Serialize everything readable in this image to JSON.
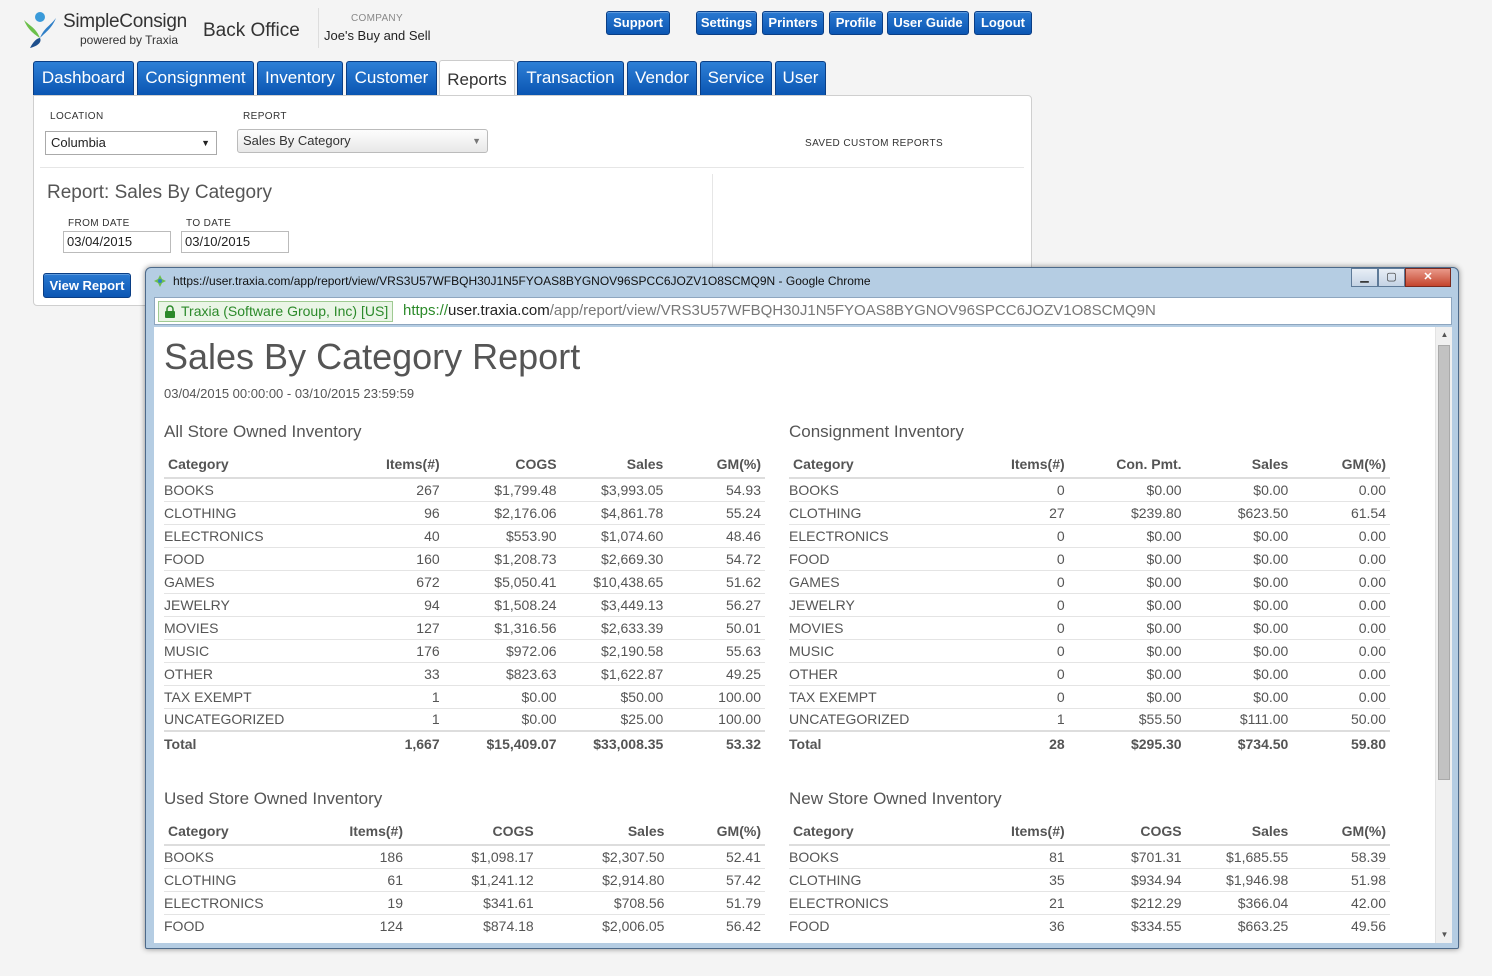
{
  "brand": {
    "name": "SimpleConsign",
    "tagline": "powered by Traxia",
    "app_title": "Back Office"
  },
  "company": {
    "label": "COMPANY",
    "name": "Joe's Buy and Sell"
  },
  "top_buttons": [
    "Support",
    "Settings",
    "Printers",
    "Profile",
    "User Guide",
    "Logout"
  ],
  "tabs": [
    "Dashboard",
    "Consignment",
    "Inventory",
    "Customer",
    "Reports",
    "Transaction",
    "Vendor",
    "Service",
    "User"
  ],
  "active_tab": "Reports",
  "filters": {
    "location_label": "LOCATION",
    "location_value": "Columbia",
    "report_label": "REPORT",
    "report_value": "Sales By Category",
    "saved_label": "SAVED CUSTOM REPORTS",
    "heading": "Report: Sales By Category",
    "from_label": "FROM DATE",
    "from_value": "03/04/2015",
    "to_label": "TO DATE",
    "to_value": "03/10/2015",
    "view_button": "View Report"
  },
  "browser": {
    "title": "https://user.traxia.com/app/report/view/VRS3U57WFBQH30J1N5FYOAS8BYGNOV96SPCC6JOZV1O8SCMQ9N - Google Chrome",
    "ev_name": "Traxia (Software Group, Inc) [US]",
    "url_scheme": "https://",
    "url_host": "user.traxia.com",
    "url_path": "/app/report/view/VRS3U57WFBQH30J1N5FYOAS8BYGNOV96SPCC6JOZV1O8SCMQ9N"
  },
  "report": {
    "title": "Sales By Category Report",
    "range": "03/04/2015 00:00:00 - 03/10/2015 23:59:59",
    "sections": [
      {
        "title": "All Store Owned Inventory",
        "headers": [
          "Category",
          "Items(#)",
          "COGS",
          "Sales",
          "GM(%)"
        ],
        "rows": [
          [
            "BOOKS",
            "267",
            "$1,799.48",
            "$3,993.05",
            "54.93"
          ],
          [
            "CLOTHING",
            "96",
            "$2,176.06",
            "$4,861.78",
            "55.24"
          ],
          [
            "ELECTRONICS",
            "40",
            "$553.90",
            "$1,074.60",
            "48.46"
          ],
          [
            "FOOD",
            "160",
            "$1,208.73",
            "$2,669.30",
            "54.72"
          ],
          [
            "GAMES",
            "672",
            "$5,050.41",
            "$10,438.65",
            "51.62"
          ],
          [
            "JEWELRY",
            "94",
            "$1,508.24",
            "$3,449.13",
            "56.27"
          ],
          [
            "MOVIES",
            "127",
            "$1,316.56",
            "$2,633.39",
            "50.01"
          ],
          [
            "MUSIC",
            "176",
            "$972.06",
            "$2,190.58",
            "55.63"
          ],
          [
            "OTHER",
            "33",
            "$823.63",
            "$1,622.87",
            "49.25"
          ],
          [
            "TAX EXEMPT",
            "1",
            "$0.00",
            "$50.00",
            "100.00"
          ],
          [
            "UNCATEGORIZED",
            "1",
            "$0.00",
            "$25.00",
            "100.00"
          ]
        ],
        "total": [
          "Total",
          "1,667",
          "$15,409.07",
          "$33,008.35",
          "53.32"
        ]
      },
      {
        "title": "Consignment Inventory",
        "headers": [
          "Category",
          "Items(#)",
          "Con. Pmt.",
          "Sales",
          "GM(%)"
        ],
        "rows": [
          [
            "BOOKS",
            "0",
            "$0.00",
            "$0.00",
            "0.00"
          ],
          [
            "CLOTHING",
            "27",
            "$239.80",
            "$623.50",
            "61.54"
          ],
          [
            "ELECTRONICS",
            "0",
            "$0.00",
            "$0.00",
            "0.00"
          ],
          [
            "FOOD",
            "0",
            "$0.00",
            "$0.00",
            "0.00"
          ],
          [
            "GAMES",
            "0",
            "$0.00",
            "$0.00",
            "0.00"
          ],
          [
            "JEWELRY",
            "0",
            "$0.00",
            "$0.00",
            "0.00"
          ],
          [
            "MOVIES",
            "0",
            "$0.00",
            "$0.00",
            "0.00"
          ],
          [
            "MUSIC",
            "0",
            "$0.00",
            "$0.00",
            "0.00"
          ],
          [
            "OTHER",
            "0",
            "$0.00",
            "$0.00",
            "0.00"
          ],
          [
            "TAX EXEMPT",
            "0",
            "$0.00",
            "$0.00",
            "0.00"
          ],
          [
            "UNCATEGORIZED",
            "1",
            "$55.50",
            "$111.00",
            "50.00"
          ]
        ],
        "total": [
          "Total",
          "28",
          "$295.30",
          "$734.50",
          "59.80"
        ]
      },
      {
        "title": "Used Store Owned Inventory",
        "headers": [
          "Category",
          "Items(#)",
          "COGS",
          "Sales",
          "GM(%)"
        ],
        "rows": [
          [
            "BOOKS",
            "186",
            "$1,098.17",
            "$2,307.50",
            "52.41"
          ],
          [
            "CLOTHING",
            "61",
            "$1,241.12",
            "$2,914.80",
            "57.42"
          ],
          [
            "ELECTRONICS",
            "19",
            "$341.61",
            "$708.56",
            "51.79"
          ],
          [
            "FOOD",
            "124",
            "$874.18",
            "$2,006.05",
            "56.42"
          ]
        ]
      },
      {
        "title": "New Store Owned Inventory",
        "headers": [
          "Category",
          "Items(#)",
          "COGS",
          "Sales",
          "GM(%)"
        ],
        "rows": [
          [
            "BOOKS",
            "81",
            "$701.31",
            "$1,685.55",
            "58.39"
          ],
          [
            "CLOTHING",
            "35",
            "$934.94",
            "$1,946.98",
            "51.98"
          ],
          [
            "ELECTRONICS",
            "21",
            "$212.29",
            "$366.04",
            "42.00"
          ],
          [
            "FOOD",
            "36",
            "$334.55",
            "$663.25",
            "49.56"
          ]
        ]
      }
    ]
  }
}
